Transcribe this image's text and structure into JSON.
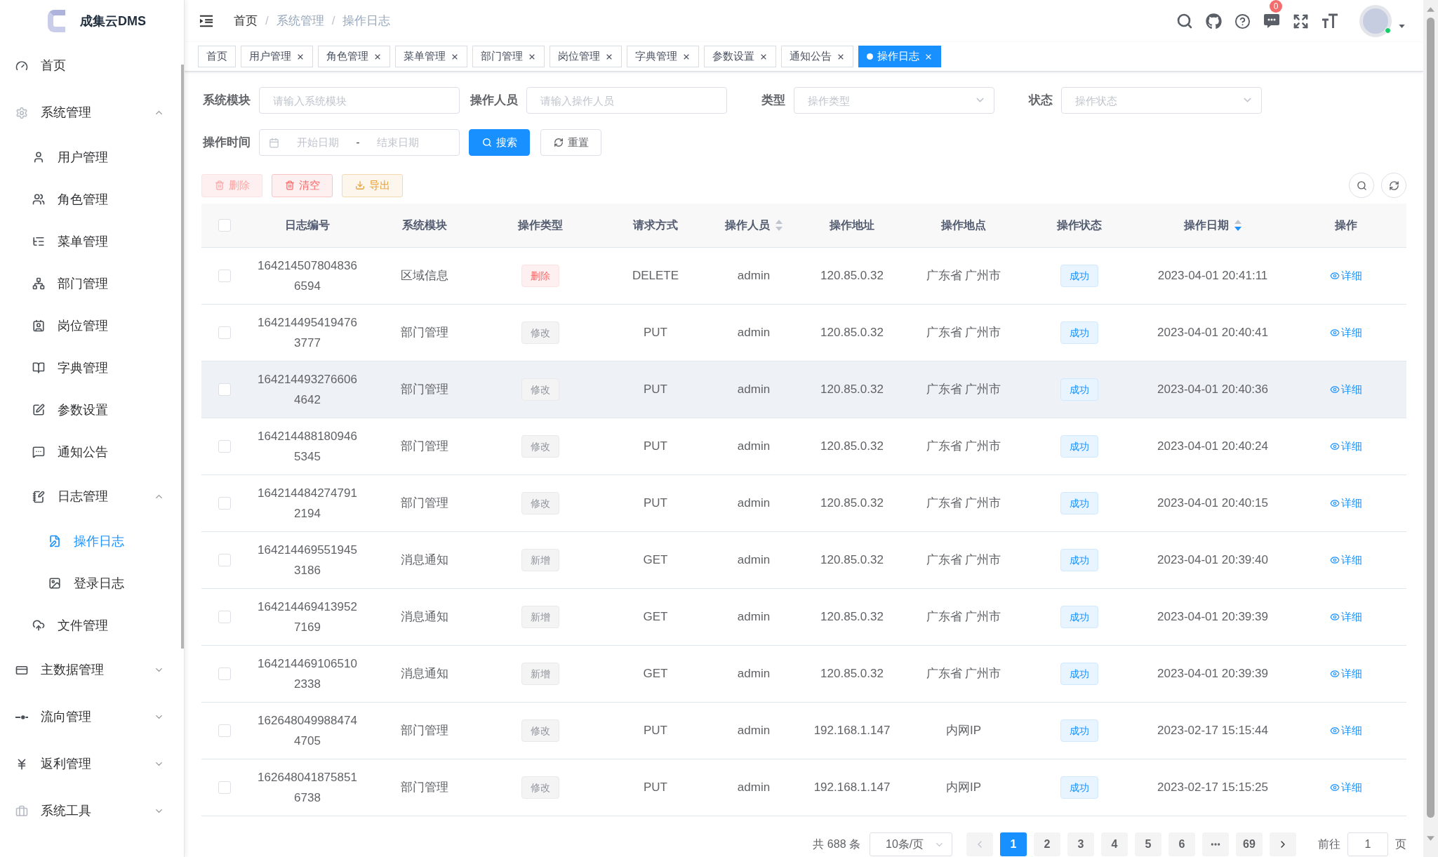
{
  "sidebar": {
    "logo_text": "成集云DMS",
    "menu": [
      {
        "label": "首页",
        "selected": false
      },
      {
        "label": "系统管理",
        "selected": false,
        "expanded": true,
        "children": [
          {
            "label": "用户管理",
            "selected": false
          },
          {
            "label": "角色管理",
            "selected": false
          },
          {
            "label": "菜单管理",
            "selected": false
          },
          {
            "label": "部门管理",
            "selected": false
          },
          {
            "label": "岗位管理",
            "selected": false
          },
          {
            "label": "字典管理",
            "selected": false
          },
          {
            "label": "参数设置",
            "selected": false
          },
          {
            "label": "通知公告",
            "selected": false
          },
          {
            "label": "日志管理",
            "selected": false,
            "expanded": true,
            "children": [
              {
                "label": "操作日志",
                "selected": true
              },
              {
                "label": "登录日志",
                "selected": false
              }
            ]
          },
          {
            "label": "文件管理",
            "selected": false
          }
        ]
      },
      {
        "label": "主数据管理",
        "selected": false,
        "expanded": false
      },
      {
        "label": "流向管理",
        "selected": false,
        "expanded": false
      },
      {
        "label": "返利管理",
        "selected": false,
        "expanded": false
      },
      {
        "label": "系统工具",
        "selected": false,
        "expanded": false
      }
    ]
  },
  "header": {
    "breadcrumb": [
      {
        "label": "首页",
        "link": true
      },
      {
        "separator": "/",
        "label": "系统管理",
        "link": false
      },
      {
        "separator": "/",
        "label": "操作日志",
        "link": false
      }
    ],
    "message_badge": "0",
    "user": {
      "online": true
    }
  },
  "tabs": [
    {
      "label": "首页",
      "selected": false,
      "closable": false
    },
    {
      "label": "用户管理",
      "selected": false,
      "closable": true
    },
    {
      "label": "角色管理",
      "selected": false,
      "closable": true
    },
    {
      "label": "菜单管理",
      "selected": false,
      "closable": true
    },
    {
      "label": "部门管理",
      "selected": false,
      "closable": true
    },
    {
      "label": "岗位管理",
      "selected": false,
      "closable": true
    },
    {
      "label": "字典管理",
      "selected": false,
      "closable": true
    },
    {
      "label": "参数设置",
      "selected": false,
      "closable": true
    },
    {
      "label": "通知公告",
      "selected": false,
      "closable": true
    },
    {
      "label": "操作日志",
      "selected": true,
      "closable": true
    }
  ],
  "filters": {
    "fields": [
      {
        "kind": "input",
        "label": "系统模块",
        "placeholder": "请输入系统模块"
      },
      {
        "kind": "input",
        "label": "操作人员",
        "placeholder": "请输入操作人员"
      },
      {
        "kind": "select",
        "label": "类型",
        "placeholder": "操作类型"
      },
      {
        "kind": "select",
        "label": "状态",
        "placeholder": "操作状态"
      }
    ],
    "date_range": {
      "label": "操作时间",
      "start_placeholder": "开始日期",
      "separator": "-",
      "end_placeholder": "结束日期"
    },
    "buttons": [
      {
        "kind": "primary",
        "label": "搜索"
      },
      {
        "kind": "default",
        "label": "重置"
      }
    ]
  },
  "toolbar": {
    "buttons": [
      {
        "kind": "danger",
        "label": "删除",
        "disabled": true
      },
      {
        "kind": "danger",
        "label": "清空",
        "disabled": false
      },
      {
        "kind": "warning",
        "label": "导出",
        "disabled": false
      }
    ]
  },
  "table": {
    "header_checked": false,
    "columns": [
      {
        "label": "日志编号"
      },
      {
        "label": "系统模块"
      },
      {
        "label": "操作类型"
      },
      {
        "label": "请求方式"
      },
      {
        "label": "操作人员",
        "sort_descending": false
      },
      {
        "label": "操作地址"
      },
      {
        "label": "操作地点"
      },
      {
        "label": "操作状态"
      },
      {
        "label": "操作日期",
        "sort_descending": true
      },
      {
        "label": "操作"
      }
    ],
    "rows": [
      {
        "checked": false,
        "hovered": false,
        "log_no": "1642145078048366594",
        "module": "区域信息",
        "type": {
          "label": "删除",
          "kind": "danger"
        },
        "method": "DELETE",
        "operator": "admin",
        "ip": "120.85.0.32",
        "location": "广东省 广州市",
        "status": "成功",
        "time": "2023-04-01 20:41:11",
        "action": "详细"
      },
      {
        "checked": false,
        "hovered": false,
        "log_no": "1642144954194763777",
        "module": "部门管理",
        "type": {
          "label": "修改",
          "kind": "info"
        },
        "method": "PUT",
        "operator": "admin",
        "ip": "120.85.0.32",
        "location": "广东省 广州市",
        "status": "成功",
        "time": "2023-04-01 20:40:41",
        "action": "详细"
      },
      {
        "checked": false,
        "hovered": true,
        "log_no": "1642144932766064642",
        "module": "部门管理",
        "type": {
          "label": "修改",
          "kind": "info"
        },
        "method": "PUT",
        "operator": "admin",
        "ip": "120.85.0.32",
        "location": "广东省 广州市",
        "status": "成功",
        "time": "2023-04-01 20:40:36",
        "action": "详细"
      },
      {
        "checked": false,
        "hovered": false,
        "log_no": "1642144881809465345",
        "module": "部门管理",
        "type": {
          "label": "修改",
          "kind": "info"
        },
        "method": "PUT",
        "operator": "admin",
        "ip": "120.85.0.32",
        "location": "广东省 广州市",
        "status": "成功",
        "time": "2023-04-01 20:40:24",
        "action": "详细"
      },
      {
        "checked": false,
        "hovered": false,
        "log_no": "1642144842747912194",
        "module": "部门管理",
        "type": {
          "label": "修改",
          "kind": "info"
        },
        "method": "PUT",
        "operator": "admin",
        "ip": "120.85.0.32",
        "location": "广东省 广州市",
        "status": "成功",
        "time": "2023-04-01 20:40:15",
        "action": "详细"
      },
      {
        "checked": false,
        "hovered": false,
        "log_no": "1642144695519453186",
        "module": "消息通知",
        "type": {
          "label": "新增",
          "kind": "info"
        },
        "method": "GET",
        "operator": "admin",
        "ip": "120.85.0.32",
        "location": "广东省 广州市",
        "status": "成功",
        "time": "2023-04-01 20:39:40",
        "action": "详细"
      },
      {
        "checked": false,
        "hovered": false,
        "log_no": "1642144694139527169",
        "module": "消息通知",
        "type": {
          "label": "新增",
          "kind": "info"
        },
        "method": "GET",
        "operator": "admin",
        "ip": "120.85.0.32",
        "location": "广东省 广州市",
        "status": "成功",
        "time": "2023-04-01 20:39:39",
        "action": "详细"
      },
      {
        "checked": false,
        "hovered": false,
        "log_no": "1642144691065102338",
        "module": "消息通知",
        "type": {
          "label": "新增",
          "kind": "info"
        },
        "method": "GET",
        "operator": "admin",
        "ip": "120.85.0.32",
        "location": "广东省 广州市",
        "status": "成功",
        "time": "2023-04-01 20:39:39",
        "action": "详细"
      },
      {
        "checked": false,
        "hovered": false,
        "log_no": "1626480499884744705",
        "module": "部门管理",
        "type": {
          "label": "修改",
          "kind": "info"
        },
        "method": "PUT",
        "operator": "admin",
        "ip": "192.168.1.147",
        "location": "内网IP",
        "status": "成功",
        "time": "2023-02-17 15:15:44",
        "action": "详细"
      },
      {
        "checked": false,
        "hovered": false,
        "log_no": "1626480418758516738",
        "module": "部门管理",
        "type": {
          "label": "修改",
          "kind": "info"
        },
        "method": "PUT",
        "operator": "admin",
        "ip": "192.168.1.147",
        "location": "内网IP",
        "status": "成功",
        "time": "2023-02-17 15:15:25",
        "action": "详细"
      }
    ]
  },
  "pagination": {
    "total": "共 688 条",
    "page_size": "10条/页",
    "prev_disabled": true,
    "pages": [
      {
        "kind": "page",
        "label": "1",
        "selected": true
      },
      {
        "kind": "page",
        "label": "2",
        "selected": false
      },
      {
        "kind": "page",
        "label": "3",
        "selected": false
      },
      {
        "kind": "page",
        "label": "4",
        "selected": false
      },
      {
        "kind": "page",
        "label": "5",
        "selected": false
      },
      {
        "kind": "page",
        "label": "6",
        "selected": false
      },
      {
        "kind": "more",
        "selected": false
      },
      {
        "kind": "page",
        "label": "69",
        "selected": false
      }
    ],
    "next_disabled": false,
    "jump_label": "前往",
    "jump_value": "1",
    "jump_unit": "页"
  }
}
